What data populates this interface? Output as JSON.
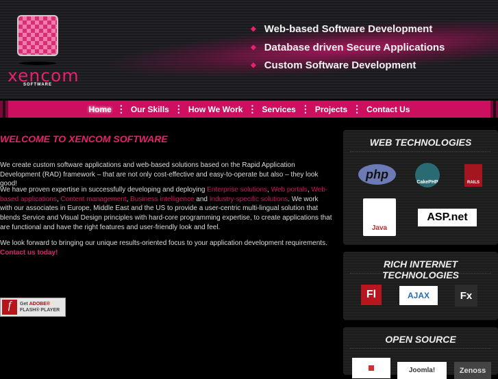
{
  "header": {
    "logo_text": "xencom",
    "logo_sub": "SOFTWARE",
    "taglines": [
      "Web-based Software Development",
      "Database driven Secure Applications",
      "Custom Software Development"
    ]
  },
  "nav": [
    "Home",
    "Our Skills",
    "How We Work",
    "Services",
    "Projects",
    "Contact Us"
  ],
  "main": {
    "title": "WELCOME TO XENCOM SOFTWARE",
    "p1": "We create custom software applications and web-based solutions based on the Rapid Application Development (RAD) framework – that are not only cost-effective and easy-to-operate but also – they look good!",
    "p2_intro": "We have proven expertise in successfully developing and deploying ",
    "p2_links": [
      "Enterprise solutions",
      "Web portals",
      "Web-based applications",
      "Content management",
      "Business intelligence",
      "Industry-specific solutions"
    ],
    "p2_and": " and ",
    "p2_rest": ". We work with our associates in Europe, Middle East and the US to provide a user-centric multi-lingual solution that blends Service and Visual Design principles with hard-core programming expertise, to create applications that are functional and have the right features and user-friendly look and feel.",
    "p3": "We look forward to bringing our unique results-oriented focus to your application development requirements.",
    "contact": "Contact us today!",
    "flash": {
      "get": "Get ",
      "adobe": "ADOBE®",
      "player": "FLASH® PLAYER"
    }
  },
  "sidebar": [
    {
      "title": "WEB TECHNOLOGIES",
      "logos": [
        "php",
        "CakePHP",
        "RAILS",
        "Java",
        "ASP.net"
      ]
    },
    {
      "title": "RICH INTERNET TECHNOLOGIES",
      "logos": [
        "Fl",
        "AJAX",
        "Fx"
      ]
    },
    {
      "title": "OPEN SOURCE",
      "logos": [
        "Joomla!",
        "Zenoss"
      ]
    }
  ]
}
